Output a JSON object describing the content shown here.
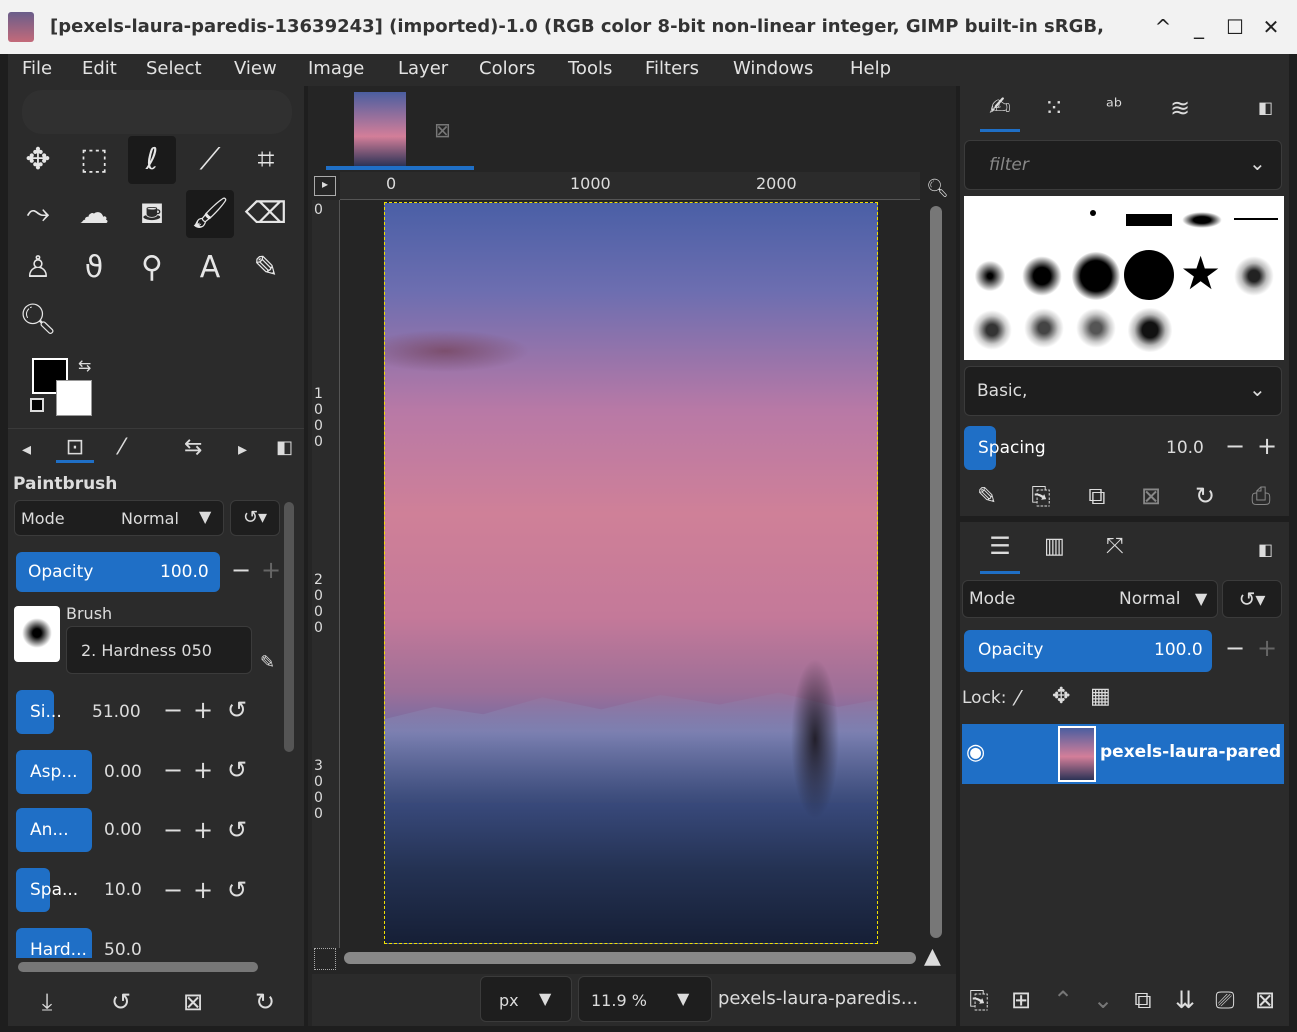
{
  "window": {
    "title": "[pexels-laura-paredis-13639243] (imported)-1.0 (RGB color 8-bit non-linear integer, GIMP built-in sRGB,",
    "buttons": [
      "^",
      "_",
      "☐",
      "✕"
    ]
  },
  "menu": [
    "File",
    "Edit",
    "Select",
    "View",
    "Image",
    "Layer",
    "Colors",
    "Tools",
    "Filters",
    "Windows",
    "Help"
  ],
  "tool_options": {
    "title": "Paintbrush",
    "mode_label": "Mode",
    "mode_value": "Normal",
    "opacity_label": "Opacity",
    "opacity_value": "100.0",
    "brush_label": "Brush",
    "brush_name": "2. Hardness 050",
    "sliders": [
      {
        "label": "Si...",
        "value": "51.00"
      },
      {
        "label": "Asp...",
        "value": "0.00"
      },
      {
        "label": "An...",
        "value": "0.00"
      },
      {
        "label": "Spa...",
        "value": "10.0"
      },
      {
        "label": "Hard...",
        "value": "50.0"
      }
    ]
  },
  "canvas": {
    "ruler_top": [
      "0",
      "1000",
      "2000"
    ],
    "ruler_left": [
      "0",
      "1000",
      "2000",
      "3000"
    ],
    "unit": "px",
    "zoom": "11.9 %",
    "status_name": "pexels-laura-paredis..."
  },
  "brushes_panel": {
    "filter_placeholder": "filter",
    "preset": "Basic,",
    "spacing_label": "Spacing",
    "spacing_value": "10.0"
  },
  "layers_panel": {
    "mode_label": "Mode",
    "mode_value": "Normal",
    "opacity_label": "Opacity",
    "opacity_value": "100.0",
    "lock_label": "Lock:",
    "layer_name": "pexels-laura-pared"
  },
  "colors": {
    "accent": "#1f6fc6",
    "fg": "#000000",
    "bg": "#ffffff"
  }
}
